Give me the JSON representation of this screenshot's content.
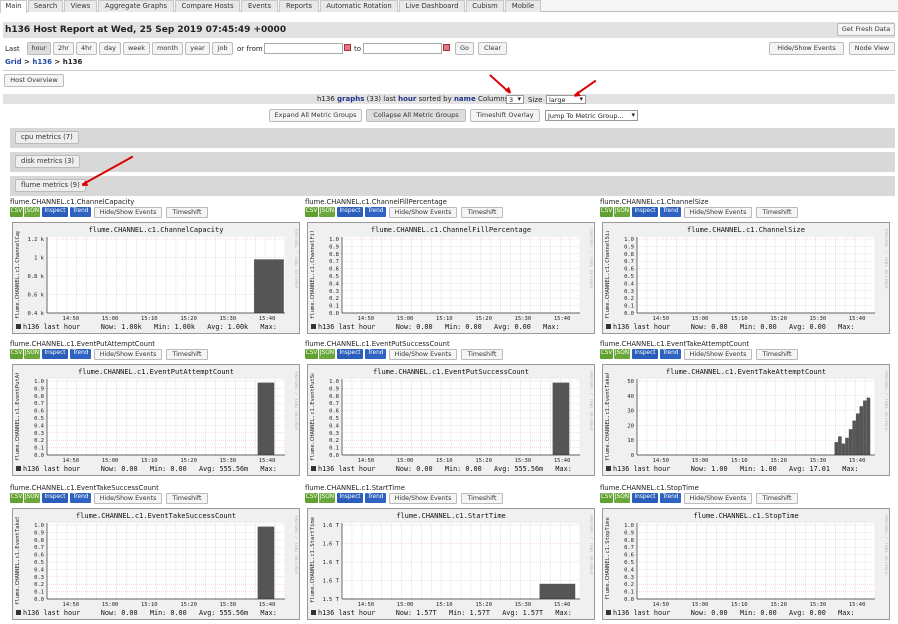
{
  "tabs": [
    "Main",
    "Search",
    "Views",
    "Aggregate Graphs",
    "Compare Hosts",
    "Events",
    "Reports",
    "Automatic Rotation",
    "Live Dashboard",
    "Cubism",
    "Mobile"
  ],
  "header": {
    "title": "h136 Host Report at Wed, 25 Sep 2019 07:45:49 +0000",
    "get_fresh": "Get Fresh Data"
  },
  "range": {
    "last_label": "Last",
    "options": [
      "hour",
      "2hr",
      "4hr",
      "day",
      "week",
      "month",
      "year",
      "job"
    ],
    "or_from": "or from",
    "to": "to",
    "go": "Go",
    "clear": "Clear",
    "hide_show": "Hide/Show Events",
    "node_view": "Node View"
  },
  "breadcrumb": {
    "grid": "Grid",
    "sep1": ">",
    "host": "h136",
    "sep2": ">",
    "current": "h136"
  },
  "host_overview": "Host Overview",
  "graphs_bar": {
    "host": "h136",
    "graphs": "graphs",
    "count": "(33)",
    "last": "last",
    "hour": "hour",
    "sorted_by": "sorted by",
    "name": "name",
    "columns_label": "Columns",
    "columns_value": "3",
    "size_label": "Size",
    "size_value": "large"
  },
  "toolbar": {
    "expand": "Expand All Metric Groups",
    "collapse": "Collapse All Metric Groups",
    "timeshift": "Timeshift Overlay",
    "jump": "Jump To Metric Group..."
  },
  "groups": [
    "cpu metrics (7)",
    "disk metrics (3)",
    "flume metrics (9)"
  ],
  "graph_buttons": {
    "csv": "CSV",
    "json": "JSON",
    "inspect": "Inspect",
    "trend": "Trend",
    "events": "Hide/Show Events",
    "timeshift": "Timeshift"
  },
  "x_ticks": [
    "14:50",
    "15:00",
    "15:10",
    "15:20",
    "15:30",
    "15:40"
  ],
  "legend_host": "h136 last hour",
  "side_text": "RRDTOOL / TOBI OETIKER",
  "graphs": [
    {
      "name": "flume.CHANNEL.c1.ChannelCapacity",
      "y_ticks": [
        "1.2 k",
        "1 k",
        "0.8 k",
        "0.6 k",
        "0.4 k"
      ],
      "ymin": 400,
      "ymax": 1250,
      "bars": [
        [
          0.87,
          0.995,
          1000
        ]
      ],
      "now": "1.00k",
      "min": "1.00k",
      "avg": "1.00k"
    },
    {
      "name": "flume.CHANNEL.c1.ChannelFillPercentage",
      "y_ticks": [
        "1.0",
        "0.9",
        "0.8",
        "0.7",
        "0.6",
        "0.5",
        "0.4",
        "0.3",
        "0.2",
        "0.1",
        "0.0"
      ],
      "ymin": 0,
      "ymax": 1.05,
      "bars": [],
      "now": "0.00",
      "min": "0.00",
      "avg": "0.00"
    },
    {
      "name": "flume.CHANNEL.c1.ChannelSize",
      "y_ticks": [
        "1.0",
        "0.9",
        "0.8",
        "0.7",
        "0.6",
        "0.5",
        "0.4",
        "0.3",
        "0.2",
        "0.1",
        "0.0"
      ],
      "ymin": 0,
      "ymax": 1.05,
      "bars": [],
      "now": "0.00",
      "min": "0.00",
      "avg": "0.00"
    },
    {
      "name": "flume.CHANNEL.c1.EventPutAttemptCount",
      "y_ticks": [
        "1.0",
        "0.9",
        "0.8",
        "0.7",
        "0.6",
        "0.5",
        "0.4",
        "0.3",
        "0.2",
        "0.1",
        "0.0"
      ],
      "ymin": 0,
      "ymax": 1.05,
      "bars": [
        [
          0.885,
          0.955,
          1
        ]
      ],
      "now": "0.00",
      "min": "0.00",
      "avg": "555.56m"
    },
    {
      "name": "flume.CHANNEL.c1.EventPutSuccessCount",
      "y_ticks": [
        "1.0",
        "0.9",
        "0.8",
        "0.7",
        "0.6",
        "0.5",
        "0.4",
        "0.3",
        "0.2",
        "0.1",
        "0.0"
      ],
      "ymin": 0,
      "ymax": 1.05,
      "bars": [
        [
          0.885,
          0.955,
          1
        ]
      ],
      "now": "0.00",
      "min": "0.00",
      "avg": "555.56m"
    },
    {
      "name": "flume.CHANNEL.c1.EventTakeAttemptCount",
      "y_ticks": [
        "50",
        "40",
        "30",
        "20",
        "10",
        "0"
      ],
      "ymin": 0,
      "ymax": 53,
      "bars": [
        [
          0.83,
          0.845,
          9
        ],
        [
          0.845,
          0.86,
          13
        ],
        [
          0.86,
          0.875,
          8
        ],
        [
          0.875,
          0.89,
          12
        ],
        [
          0.89,
          0.905,
          18
        ],
        [
          0.905,
          0.92,
          24
        ],
        [
          0.92,
          0.935,
          29
        ],
        [
          0.935,
          0.95,
          34
        ],
        [
          0.95,
          0.965,
          38
        ],
        [
          0.965,
          0.98,
          40
        ]
      ],
      "now": "1.00",
      "min": "1.00",
      "avg": "17.01"
    },
    {
      "name": "flume.CHANNEL.c1.EventTakeSuccessCount",
      "y_ticks": [
        "1.0",
        "0.9",
        "0.8",
        "0.7",
        "0.6",
        "0.5",
        "0.4",
        "0.3",
        "0.2",
        "0.1",
        "0.0"
      ],
      "ymin": 0,
      "ymax": 1.05,
      "bars": [
        [
          0.885,
          0.955,
          1
        ]
      ],
      "now": "0.00",
      "min": "0.00",
      "avg": "555.56m"
    },
    {
      "name": "flume.CHANNEL.c1.StartTime",
      "y_ticks": [
        "1.6 T",
        "1.6 T",
        "1.6 T",
        "1.6 T",
        "1.5 T"
      ],
      "ymin": 0,
      "ymax": 5,
      "bars": [
        [
          0.83,
          0.98,
          1
        ]
      ],
      "now": "1.57T",
      "min": "1.57T",
      "avg": "1.57T"
    },
    {
      "name": "flume.CHANNEL.c1.StopTime",
      "y_ticks": [
        "1.0",
        "0.9",
        "0.8",
        "0.7",
        "0.6",
        "0.5",
        "0.4",
        "0.3",
        "0.2",
        "0.1",
        "0.0"
      ],
      "ymin": 0,
      "ymax": 1.05,
      "bars": [],
      "now": "0.00",
      "min": "0.00",
      "avg": "0.00"
    }
  ],
  "legend_labels": {
    "now": "Now:",
    "min": "Min:",
    "avg": "Avg:",
    "max": "Max:"
  },
  "colors": {
    "accent_red": "#dd0000",
    "bar_fill": "#555555",
    "csv": "#5fa02f",
    "inspect": "#2b5dbb"
  }
}
